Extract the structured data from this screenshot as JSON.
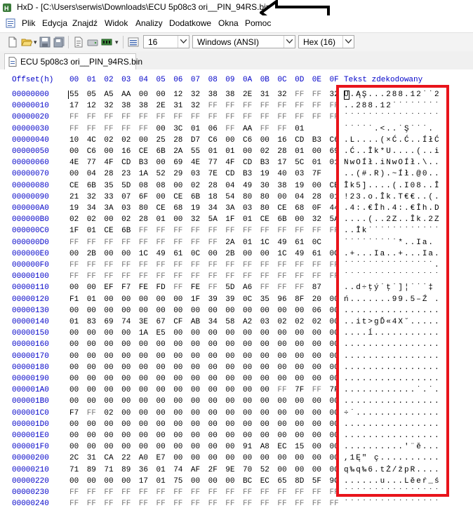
{
  "window": {
    "title": "HxD - [C:\\Users\\serwis\\Downloads\\ECU 5p08c3 ori__PIN_94RS.bin]"
  },
  "menu": [
    "Plik",
    "Edycja",
    "Znajdź",
    "Widok",
    "Analizy",
    "Dodatkowe",
    "Okna",
    "Pomoc"
  ],
  "toolbar": {
    "bytes_per_row": "16",
    "charset": "Windows (ANSI)",
    "offset_base": "Hex (16)"
  },
  "tab": {
    "label": "ECU 5p08c3 ori__PIN_94RS.bin"
  },
  "header": {
    "offset_label": "Offset(h)",
    "columns": [
      "00",
      "01",
      "02",
      "03",
      "04",
      "05",
      "06",
      "07",
      "08",
      "09",
      "0A",
      "0B",
      "0C",
      "0D",
      "0E",
      "0F"
    ],
    "text_label": "Tekst zdekodowany"
  },
  "rows": [
    {
      "addr": "00000000",
      "hex": [
        "55",
        "05",
        "A5",
        "AA",
        "00",
        "00",
        "12",
        "32",
        "38",
        "38",
        "2E",
        "31",
        "32",
        "FF",
        "FF",
        "32"
      ],
      "text": "U.ĄŞ...288.12˙˙2"
    },
    {
      "addr": "00000010",
      "hex": [
        "17",
        "12",
        "32",
        "38",
        "38",
        "2E",
        "31",
        "32",
        "FF",
        "FF",
        "FF",
        "FF",
        "FF",
        "FF",
        "FF",
        "FF"
      ],
      "text": "..288.12˙˙˙˙˙˙˙˙"
    },
    {
      "addr": "00000020",
      "hex": [
        "FF",
        "FF",
        "FF",
        "FF",
        "FF",
        "FF",
        "FF",
        "FF",
        "FF",
        "FF",
        "FF",
        "FF",
        "FF",
        "FF",
        "FF",
        "FF"
      ],
      "text": "˙˙˙˙˙˙˙˙˙˙˙˙˙˙˙˙"
    },
    {
      "addr": "00000030",
      "hex": [
        "FF",
        "FF",
        "FF",
        "FF",
        "FF",
        "00",
        "3C",
        "01",
        "06",
        "FF",
        "AA",
        "FF",
        "FF",
        "01"
      ],
      "text": "˙˙˙˙˙.<..˙Ş˙˙˙."
    },
    {
      "addr": "00000040",
      "hex": [
        "10",
        "4C",
        "02",
        "02",
        "00",
        "25",
        "28",
        "D7",
        "C6",
        "00",
        "C6",
        "00",
        "16",
        "CD",
        "B3",
        "C6"
      ],
      "text": ".L....(×Ć.Ć..ÍłĆ"
    },
    {
      "addr": "00000050",
      "hex": [
        "00",
        "C6",
        "00",
        "16",
        "CE",
        "6B",
        "2A",
        "55",
        "01",
        "01",
        "00",
        "02",
        "28",
        "01",
        "00",
        "69"
      ],
      "text": ".Ć..Îk*U....(..i"
    },
    {
      "addr": "00000060",
      "hex": [
        "4E",
        "77",
        "4F",
        "CD",
        "B3",
        "00",
        "69",
        "4E",
        "77",
        "4F",
        "CD",
        "B3",
        "17",
        "5C",
        "01",
        "01"
      ],
      "text": "NwOÍł.iNwOÍł.\\.."
    },
    {
      "addr": "00000070",
      "hex": [
        "00",
        "04",
        "28",
        "23",
        "1A",
        "52",
        "29",
        "03",
        "7E",
        "CD",
        "B3",
        "19",
        "40",
        "03",
        "7F"
      ],
      "text": "..(#.R).~Íł.@0.."
    },
    {
      "addr": "00000080",
      "hex": [
        "CE",
        "6B",
        "35",
        "5D",
        "08",
        "08",
        "00",
        "02",
        "28",
        "04",
        "49",
        "30",
        "38",
        "19",
        "00",
        "CE"
      ],
      "text": "Îk5]....(.I08..Î"
    },
    {
      "addr": "00000090",
      "hex": [
        "21",
        "32",
        "33",
        "07",
        "6F",
        "00",
        "CE",
        "6B",
        "18",
        "54",
        "80",
        "80",
        "00",
        "04",
        "28",
        "01"
      ],
      "text": "!23.o.Îk.T€€..(."
    },
    {
      "addr": "000000A0",
      "hex": [
        "19",
        "34",
        "3A",
        "03",
        "80",
        "CE",
        "68",
        "19",
        "34",
        "3A",
        "03",
        "80",
        "CE",
        "68",
        "0F",
        "44"
      ],
      "text": ".4:.€Îh.4:.€Îh.D"
    },
    {
      "addr": "000000B0",
      "hex": [
        "02",
        "02",
        "00",
        "02",
        "28",
        "01",
        "00",
        "32",
        "5A",
        "1F",
        "01",
        "CE",
        "6B",
        "00",
        "32",
        "5A"
      ],
      "text": "....(..2Z..Îk.2Z"
    },
    {
      "addr": "000000C0",
      "hex": [
        "1F",
        "01",
        "CE",
        "6B",
        "FF",
        "FF",
        "FF",
        "FF",
        "FF",
        "FF",
        "FF",
        "FF",
        "FF",
        "FF",
        "FF",
        "FF"
      ],
      "text": "..Îk˙˙˙˙˙˙˙˙˙˙˙˙"
    },
    {
      "addr": "000000D0",
      "hex": [
        "FF",
        "FF",
        "FF",
        "FF",
        "FF",
        "FF",
        "FF",
        "FF",
        "FF",
        "2A",
        "01",
        "1C",
        "49",
        "61",
        "0C"
      ],
      "text": "˙˙˙˙˙˙˙˙˙*..Ia."
    },
    {
      "addr": "000000E0",
      "hex": [
        "00",
        "2B",
        "00",
        "00",
        "1C",
        "49",
        "61",
        "0C",
        "00",
        "2B",
        "00",
        "00",
        "1C",
        "49",
        "61",
        "0C"
      ],
      "text": ".+...Ia..+...Ia."
    },
    {
      "addr": "000000F0",
      "hex": [
        "FF",
        "FF",
        "FF",
        "FF",
        "FF",
        "FF",
        "FF",
        "FF",
        "FF",
        "FF",
        "FF",
        "FF",
        "FF",
        "FF",
        "FF",
        "FF"
      ],
      "text": "˙˙˙˙˙˙˙˙˙˙˙˙˙˙˙."
    },
    {
      "addr": "00000100",
      "hex": [
        "FF",
        "FF",
        "FF",
        "FF",
        "FF",
        "FF",
        "FF",
        "FF",
        "FF",
        "FF",
        "FF",
        "FF",
        "FF",
        "FF",
        "FF",
        "FF"
      ],
      "text": "˙˙˙˙˙˙˙˙˙˙˙˙˙˙˙˙"
    },
    {
      "addr": "00000110",
      "hex": [
        "00",
        "00",
        "EF",
        "F7",
        "FE",
        "FD",
        "FF",
        "FE",
        "FF",
        "5D",
        "A6",
        "FF",
        "FF",
        "FF",
        "87"
      ],
      "text": "..d÷ţý˙ţ˙]¦˙˙˙‡"
    },
    {
      "addr": "00000120",
      "hex": [
        "F1",
        "01",
        "00",
        "00",
        "00",
        "00",
        "00",
        "1F",
        "39",
        "39",
        "0C",
        "35",
        "96",
        "8F",
        "20",
        "00"
      ],
      "text": "ń.......99.5–Ź ."
    },
    {
      "addr": "00000130",
      "hex": [
        "00",
        "00",
        "00",
        "00",
        "00",
        "00",
        "00",
        "00",
        "00",
        "00",
        "00",
        "00",
        "00",
        "00",
        "06",
        "00"
      ],
      "text": "................"
    },
    {
      "addr": "00000140",
      "hex": [
        "01",
        "83",
        "69",
        "74",
        "3E",
        "67",
        "CF",
        "AB",
        "34",
        "58",
        "A2",
        "03",
        "02",
        "02",
        "02",
        "00"
      ],
      "text": "..it>gĎ«4X˘....."
    },
    {
      "addr": "00000150",
      "hex": [
        "00",
        "00",
        "00",
        "00",
        "1A",
        "E5",
        "00",
        "00",
        "00",
        "00",
        "00",
        "00",
        "00",
        "00",
        "00",
        "00"
      ],
      "text": "....ĺ..........."
    },
    {
      "addr": "00000160",
      "hex": [
        "00",
        "00",
        "00",
        "00",
        "00",
        "00",
        "00",
        "00",
        "00",
        "00",
        "00",
        "00",
        "00",
        "00",
        "00",
        "00"
      ],
      "text": "................"
    },
    {
      "addr": "00000170",
      "hex": [
        "00",
        "00",
        "00",
        "00",
        "00",
        "00",
        "00",
        "00",
        "00",
        "00",
        "00",
        "00",
        "00",
        "00",
        "00",
        "00"
      ],
      "text": "................"
    },
    {
      "addr": "00000180",
      "hex": [
        "00",
        "00",
        "00",
        "00",
        "00",
        "00",
        "00",
        "00",
        "00",
        "00",
        "00",
        "00",
        "00",
        "00",
        "00",
        "00"
      ],
      "text": "................"
    },
    {
      "addr": "00000190",
      "hex": [
        "00",
        "00",
        "00",
        "00",
        "00",
        "00",
        "00",
        "00",
        "00",
        "00",
        "00",
        "00",
        "00",
        "00",
        "00",
        "00"
      ],
      "text": "................"
    },
    {
      "addr": "000001A0",
      "hex": [
        "00",
        "00",
        "00",
        "00",
        "00",
        "00",
        "00",
        "00",
        "00",
        "00",
        "00",
        "00",
        "FF",
        "7F",
        "FF",
        "7F"
      ],
      "text": "............˙.˙."
    },
    {
      "addr": "000001B0",
      "hex": [
        "00",
        "00",
        "00",
        "00",
        "00",
        "00",
        "00",
        "00",
        "00",
        "00",
        "00",
        "00",
        "00",
        "00",
        "00",
        "00"
      ],
      "text": "................"
    },
    {
      "addr": "000001C0",
      "hex": [
        "F7",
        "FF",
        "02",
        "00",
        "00",
        "00",
        "00",
        "00",
        "00",
        "00",
        "00",
        "00",
        "00",
        "00",
        "00",
        "00"
      ],
      "text": "÷˙.............."
    },
    {
      "addr": "000001D0",
      "hex": [
        "00",
        "00",
        "00",
        "00",
        "00",
        "00",
        "00",
        "00",
        "00",
        "00",
        "00",
        "00",
        "00",
        "00",
        "00",
        "00"
      ],
      "text": "................"
    },
    {
      "addr": "000001E0",
      "hex": [
        "00",
        "00",
        "00",
        "00",
        "00",
        "00",
        "00",
        "00",
        "00",
        "00",
        "00",
        "00",
        "00",
        "00",
        "00",
        "00"
      ],
      "text": "................"
    },
    {
      "addr": "000001F0",
      "hex": [
        "00",
        "00",
        "00",
        "00",
        "00",
        "00",
        "00",
        "00",
        "00",
        "00",
        "91",
        "A8",
        "EC",
        "15",
        "00",
        "00"
      ],
      "text": "..........'¨ě..."
    },
    {
      "addr": "00000200",
      "hex": [
        "2C",
        "31",
        "CA",
        "22",
        "A0",
        "E7",
        "00",
        "00",
        "00",
        "00",
        "00",
        "00",
        "00",
        "00",
        "00",
        "00"
      ],
      "text": ",1Ę\" ç.........."
    },
    {
      "addr": "00000210",
      "hex": [
        "71",
        "89",
        "71",
        "89",
        "36",
        "01",
        "74",
        "AF",
        "2F",
        "9E",
        "70",
        "52",
        "00",
        "00",
        "00",
        "00"
      ],
      "text": "q‰q‰6.tŻ/žpR...."
    },
    {
      "addr": "00000220",
      "hex": [
        "00",
        "00",
        "00",
        "00",
        "17",
        "01",
        "75",
        "00",
        "00",
        "00",
        "BC",
        "EC",
        "65",
        "8D",
        "5F",
        "9C"
      ],
      "text": "......u...Lěeŕ_ś"
    },
    {
      "addr": "00000230",
      "hex": [
        "FF",
        "FF",
        "FF",
        "FF",
        "FF",
        "FF",
        "FF",
        "FF",
        "FF",
        "FF",
        "FF",
        "FF",
        "FF",
        "FF",
        "FF",
        "FF"
      ],
      "text": "˙˙˙˙˙˙˙˙˙˙˙˙˙˙˙˙"
    },
    {
      "addr": "00000240",
      "hex": [
        "FF",
        "FF",
        "FF",
        "FF",
        "FF",
        "FF",
        "FF",
        "FF",
        "FF",
        "FF",
        "FF",
        "FF",
        "FF",
        "FF",
        "FF",
        "FF"
      ],
      "text": "˙˙˙˙˙˙˙˙˙˙˙˙˙˙˙˙"
    }
  ]
}
